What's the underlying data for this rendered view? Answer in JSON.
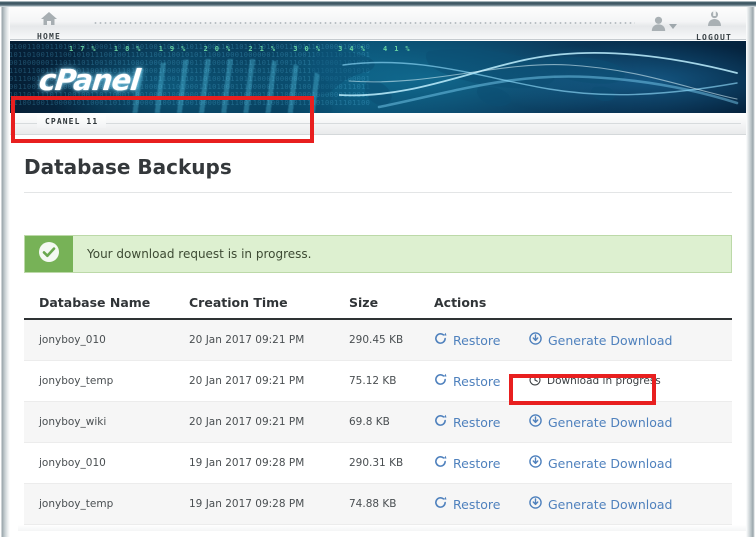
{
  "topnav": {
    "home_label": "HOME",
    "logout_label": "LOGOUT",
    "home_icon": "home-icon",
    "user_icon": "user-icon",
    "caret_icon": "chevron-down-icon",
    "logout_icon": "logout-person-icon"
  },
  "banner": {
    "logo_text": "cPanel",
    "ticker_text": "17% 18% 19% 20% 21% 30% 34% 41%",
    "binary_rows": [
      "01001101011010010110001101110010011011110111001101101111011001100111010000100000",
      "10110100101100101011100100111011001100101011100100010000001100110011011110111001",
      "00100000011101110110010101100010001000000110100001101111011100110111010001101001",
      "11011100111010001100101011011000010000001110011011001010111001001110110011001010",
      "01110010001000000110110001101111011001110110100101101110001000000111000001100001",
      "00110011101100101001000000110100001110100011101000111000001110011001000000111011",
      "10110111101110010011011000110010000100000011011010110000101110000001000000110010",
      "11100100110000101100011011010000110010100100000011100110110010101110010011101100"
    ]
  },
  "tabstrip": {
    "version_label": "CPANEL 11"
  },
  "page": {
    "title": "Database Backups"
  },
  "alert": {
    "message": "Your download request is in progress.",
    "icon": "check-circle-icon",
    "icon_bg_color": "#77b257",
    "background_color": "#ddf0d0",
    "border_color": "#bcd9a8"
  },
  "annotations": {
    "color": "#e81f1f",
    "alert_highlight": "red-rectangle-around-alert",
    "progress_highlight": "red-rectangle-around-download-in-progress"
  },
  "table": {
    "columns": [
      "Database Name",
      "Creation Time",
      "Size",
      "Actions",
      ""
    ],
    "restore_label": "Restore",
    "restore_icon": "refresh-circle-icon",
    "generate_label": "Generate Download",
    "generate_icon": "download-circle-icon",
    "progress_label": "Download in progress",
    "progress_icon": "clock-circle-icon",
    "rows": [
      {
        "name": "jonyboy_010",
        "time": "20 Jan 2017 09:21 PM",
        "size": "290.45 KB",
        "action_primary": "Restore",
        "action_secondary": "Generate Download",
        "state": "ready"
      },
      {
        "name": "jonyboy_temp",
        "time": "20 Jan 2017 09:21 PM",
        "size": "75.12 KB",
        "action_primary": "Restore",
        "action_secondary": "Download in progress",
        "state": "in-progress"
      },
      {
        "name": "jonyboy_wiki",
        "time": "20 Jan 2017 09:21 PM",
        "size": "69.8 KB",
        "action_primary": "Restore",
        "action_secondary": "Generate Download",
        "state": "ready"
      },
      {
        "name": "jonyboy_010",
        "time": "19 Jan 2017 09:28 PM",
        "size": "290.31 KB",
        "action_primary": "Restore",
        "action_secondary": "Generate Download",
        "state": "ready"
      },
      {
        "name": "jonyboy_temp",
        "time": "19 Jan 2017 09:28 PM",
        "size": "74.88 KB",
        "action_primary": "Restore",
        "action_secondary": "Generate Download",
        "state": "ready"
      }
    ]
  },
  "colors": {
    "link": "#4f81bd",
    "header_text": "#303437",
    "row_alt": "#f6f6f6"
  }
}
